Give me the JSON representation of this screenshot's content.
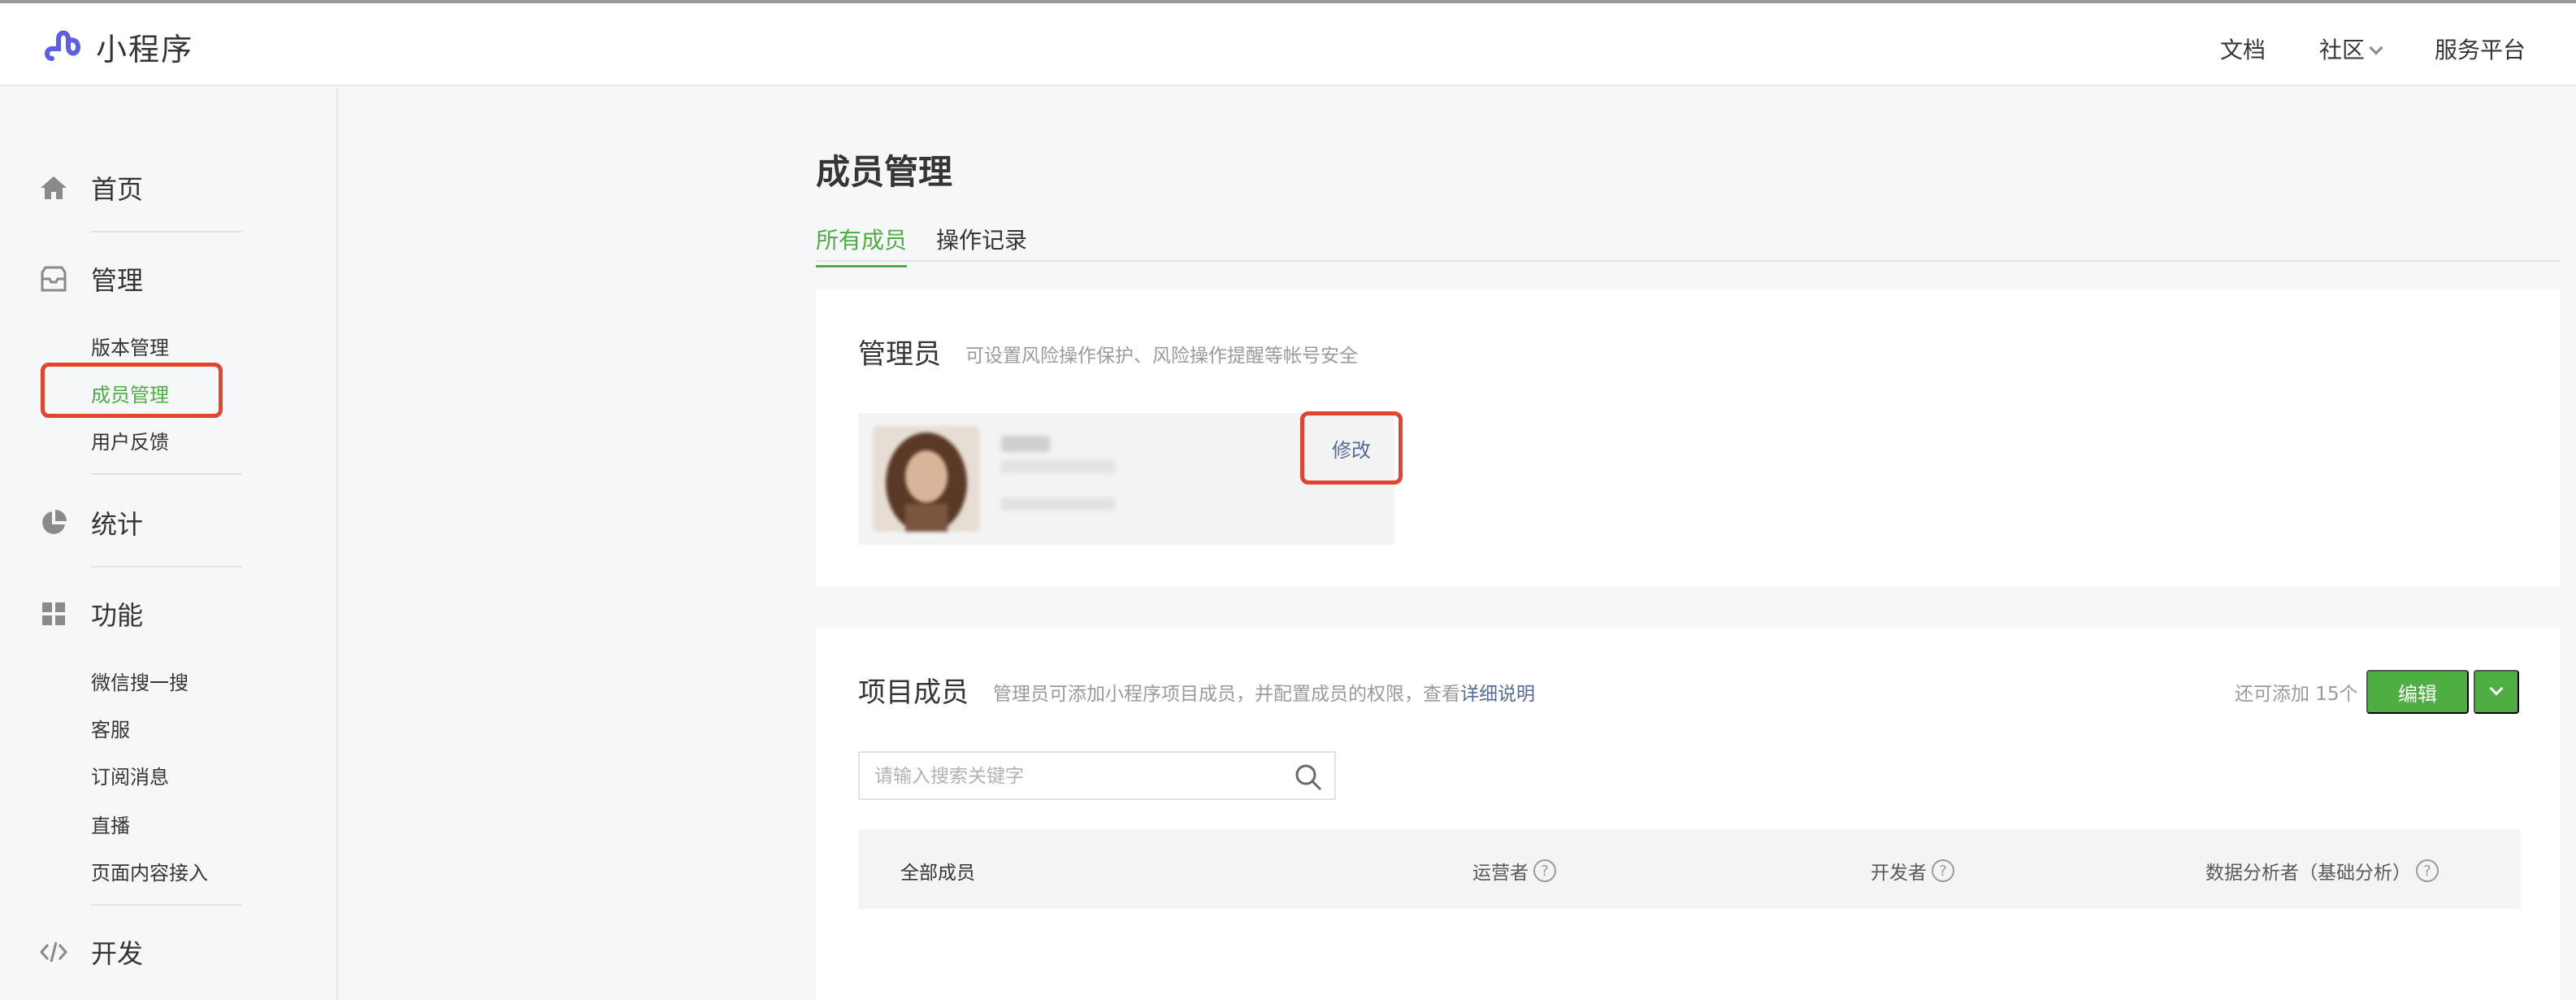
{
  "app": {
    "title": "小程序"
  },
  "topnav": {
    "doc": "文档",
    "community": "社区",
    "platform": "服务平台"
  },
  "sidebar": {
    "home": "首页",
    "manage": "管理",
    "manage_items": [
      "版本管理",
      "成员管理",
      "用户反馈"
    ],
    "stats": "统计",
    "features": "功能",
    "feature_items": [
      "微信搜一搜",
      "客服",
      "订阅消息",
      "直播",
      "页面内容接入"
    ],
    "dev": "开发"
  },
  "page": {
    "title": "成员管理",
    "tabs": [
      "所有成员",
      "操作记录"
    ]
  },
  "admin": {
    "title": "管理员",
    "desc": "可设置风险操作保护、风险操作提醒等帐号安全",
    "modify": "修改"
  },
  "members": {
    "title": "项目成员",
    "desc": "管理员可添加小程序项目成员，并配置成员的权限，查看",
    "desc_link": "详细说明",
    "quota": "还可添加 15个",
    "edit": "编辑",
    "search_placeholder": "请输入搜索关键字",
    "columns": [
      "全部成员",
      "运营者",
      "开发者",
      "数据分析者（基础分析）"
    ]
  },
  "colors": {
    "accent": "#4fae42",
    "highlight": "#e0452f",
    "link": "#576b95"
  }
}
